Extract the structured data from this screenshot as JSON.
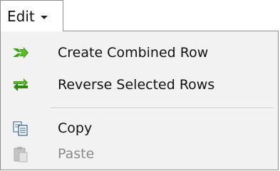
{
  "menu": {
    "title": "Edit",
    "items": [
      {
        "label": "Create Combined Row",
        "icon": "combine-rows-icon",
        "enabled": true
      },
      {
        "label": "Reverse Selected Rows",
        "icon": "reverse-rows-icon",
        "enabled": true
      },
      {
        "label": "Copy",
        "icon": "copy-icon",
        "enabled": true
      },
      {
        "label": "Paste",
        "icon": "paste-icon",
        "enabled": false
      }
    ]
  },
  "colors": {
    "icon_green": "#3aa010",
    "disabled_text": "#8a8a8a",
    "menu_background": "#f2f2f2"
  }
}
